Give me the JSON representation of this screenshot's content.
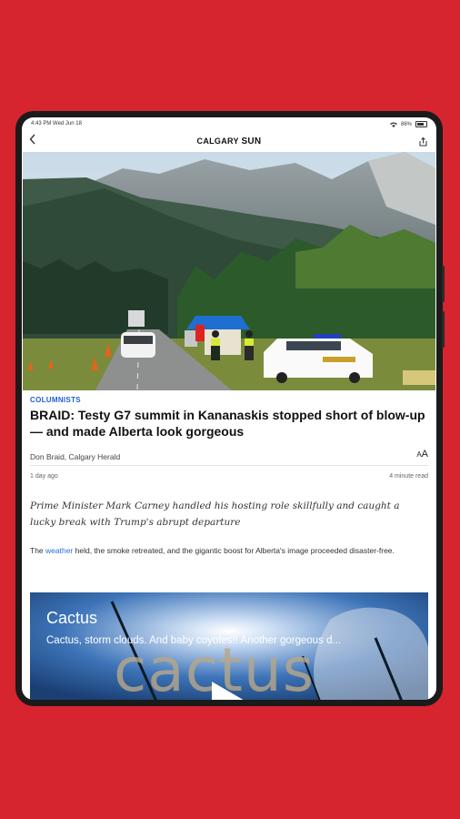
{
  "status_bar": {
    "time": "4:43 PM  Wed Jun 18",
    "battery": "86%"
  },
  "app": {
    "logo_part1": "CALGARY ",
    "logo_part2": "SUN"
  },
  "article": {
    "kicker": "COLUMNISTS",
    "headline": "BRAID: Testy G7 summit in Kananaskis stopped short of blow-up — and made Alberta look gorgeous",
    "byline": "Don Braid, Calgary Herald",
    "font_size_control": "AA",
    "age": "1 day ago",
    "read_time": "4 minute read",
    "deck": "Prime Minister Mark Carney handled his hosting role skillfully and caught a lucky break with Trump's abrupt departure",
    "body_before_link": "The ",
    "body_link": "weather",
    "body_after_link": " held, the smoke retreated, and the gigantic boost for Alberta's image proceeded disaster-free."
  },
  "video": {
    "title": "Cactus",
    "description": "Cactus, storm clouds. And baby coyotes!! Another gorgeous d...",
    "overlay_word": "cactus"
  },
  "icons": {
    "back": "chevron-left-icon",
    "share": "share-icon",
    "play": "play-icon",
    "wifi": "wifi-icon",
    "battery": "battery-icon"
  },
  "colors": {
    "background": "#d6252f",
    "accent_link": "#2a6fdb",
    "kicker": "#1f5fd4"
  }
}
